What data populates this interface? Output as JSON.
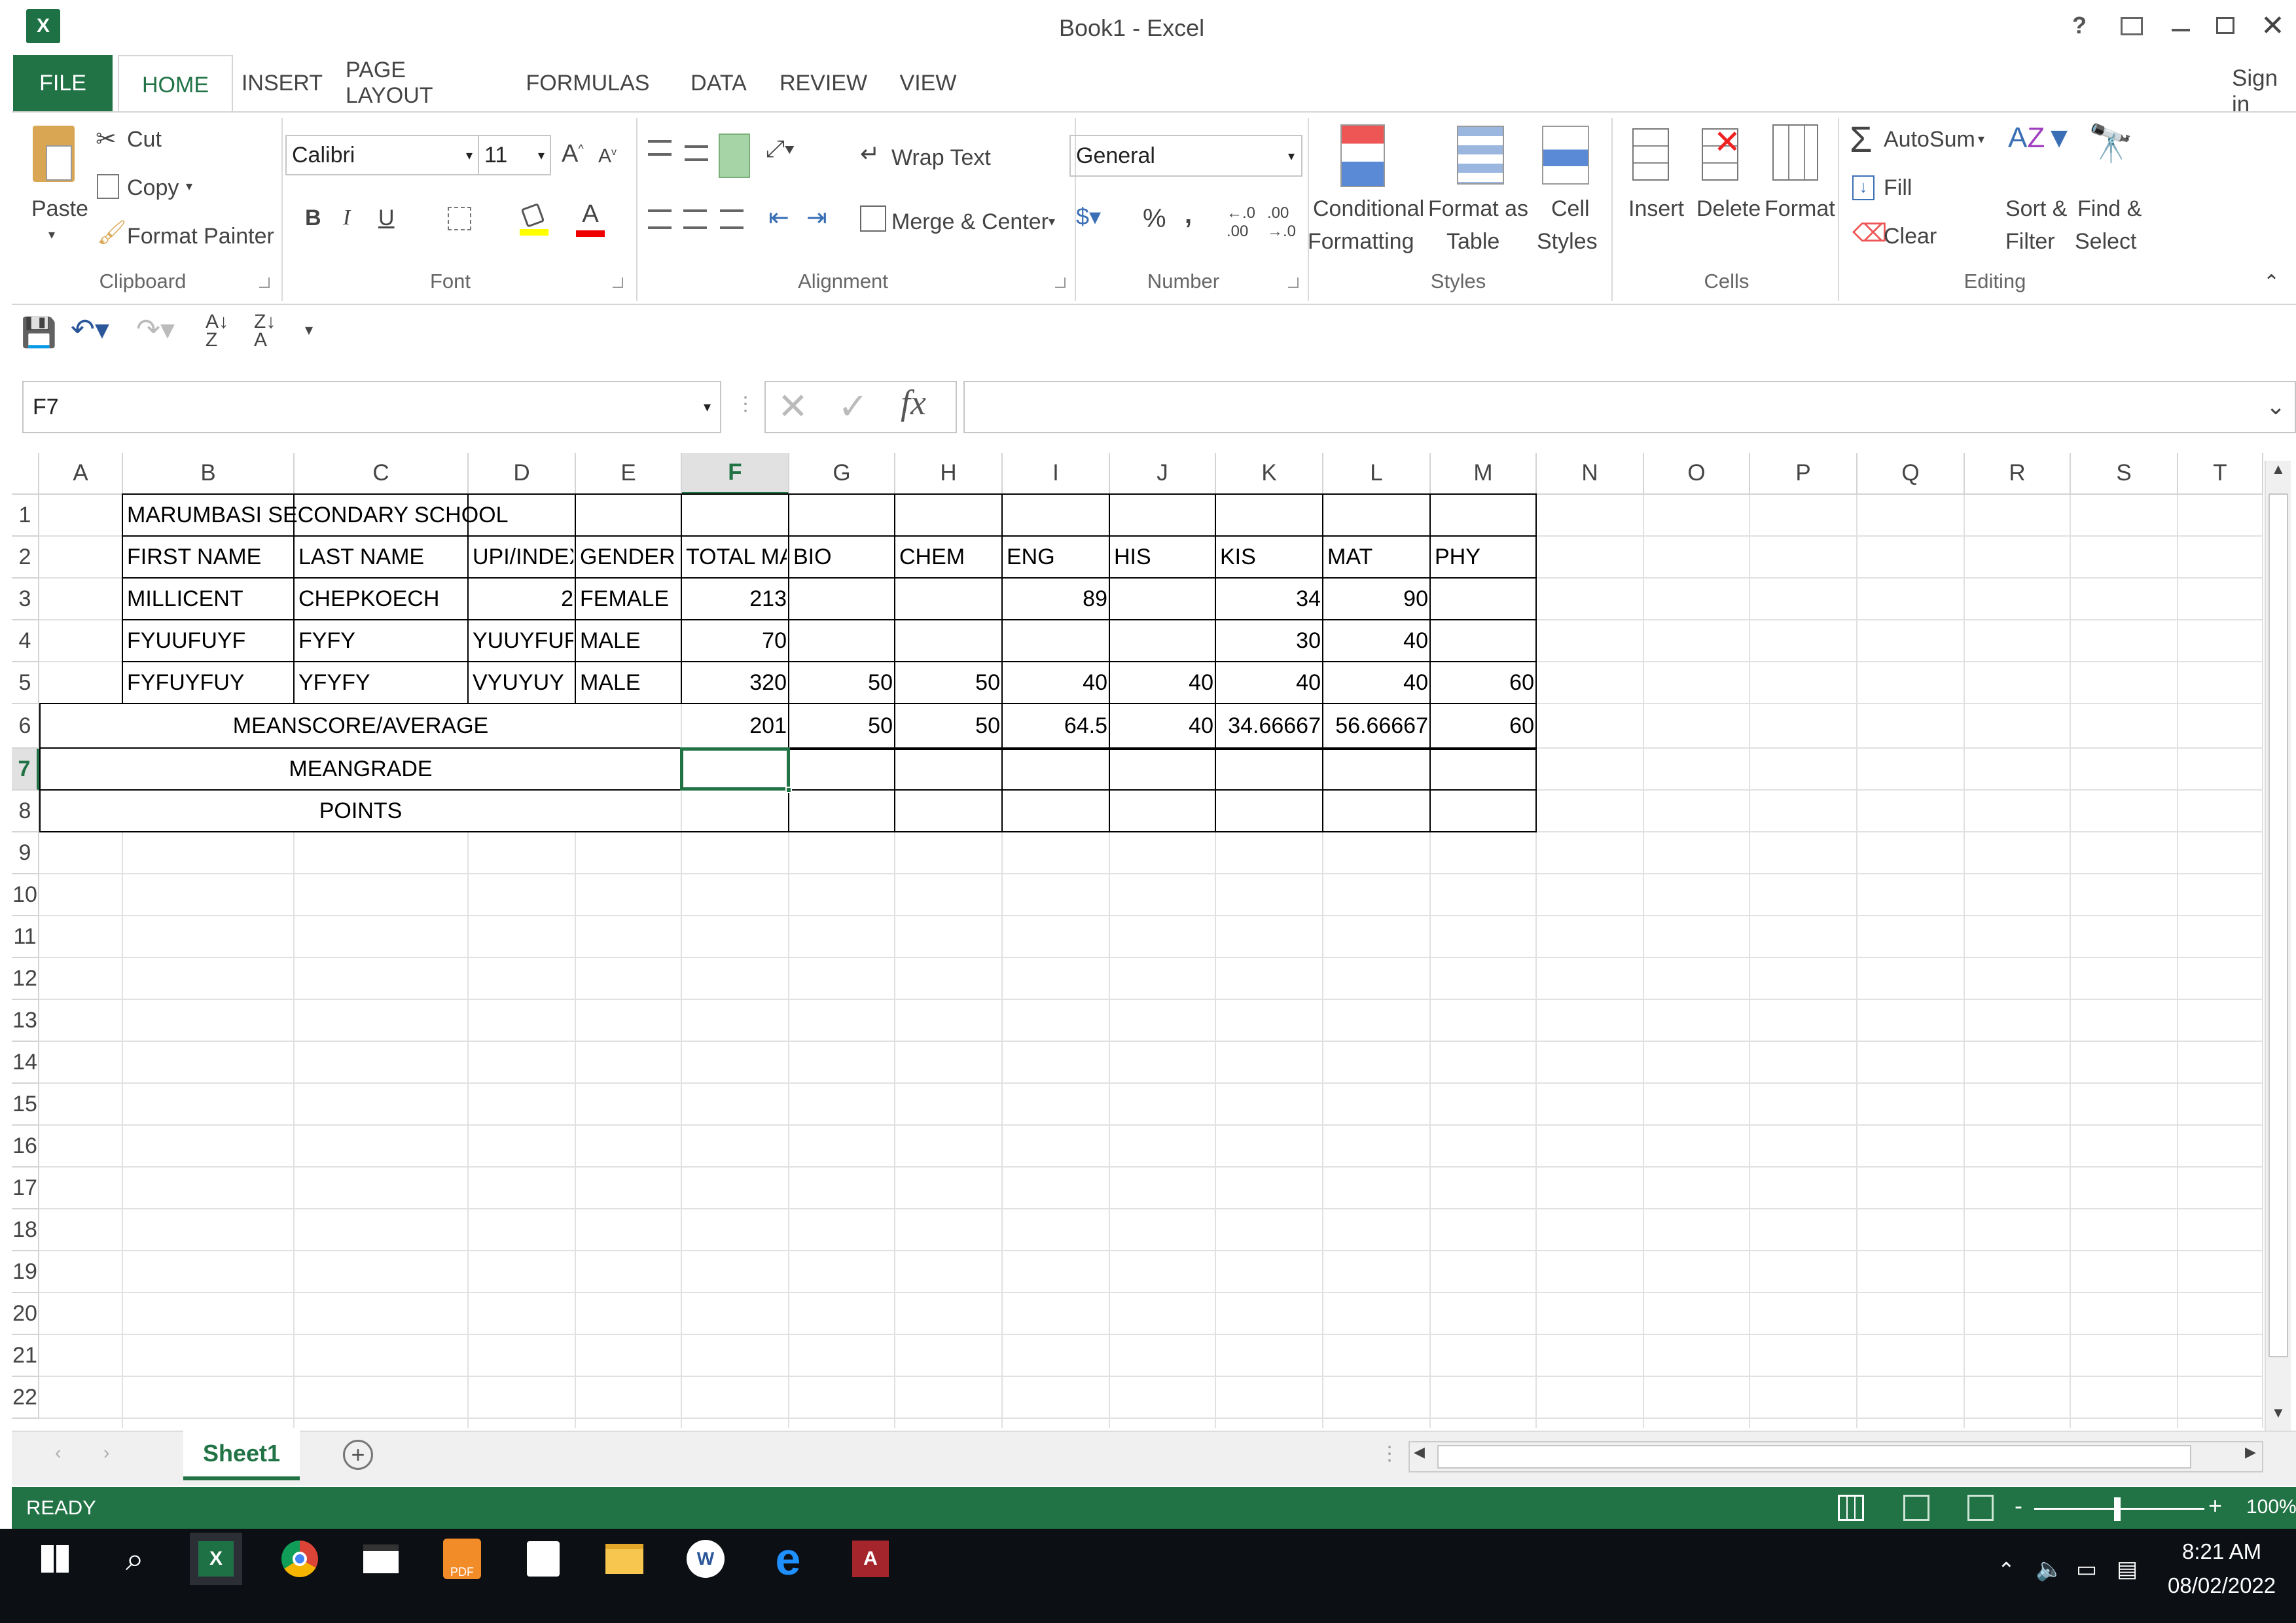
{
  "window": {
    "title": "Book1 - Excel",
    "sign_in": "Sign in",
    "help": "?"
  },
  "tabs": [
    "FILE",
    "HOME",
    "INSERT",
    "PAGE LAYOUT",
    "FORMULAS",
    "DATA",
    "REVIEW",
    "VIEW"
  ],
  "clipboard": {
    "paste": "Paste",
    "cut": "Cut",
    "copy": "Copy",
    "format_painter": "Format Painter",
    "group": "Clipboard"
  },
  "font": {
    "name": "Calibri",
    "size": "11",
    "group": "Font",
    "bold": "B",
    "italic": "I",
    "underline": "U"
  },
  "alignment": {
    "wrap": "Wrap Text",
    "merge": "Merge & Center",
    "group": "Alignment"
  },
  "number": {
    "format": "General",
    "group": "Number",
    "percent": "%",
    "comma": ","
  },
  "styles": {
    "cond1": "Conditional",
    "cond2": "Formatting",
    "fmt1": "Format as",
    "fmt2": "Table",
    "cell1": "Cell",
    "cell2": "Styles",
    "group": "Styles"
  },
  "cells": {
    "insert": "Insert",
    "delete": "Delete",
    "format": "Format",
    "group": "Cells"
  },
  "editing": {
    "autosum": "AutoSum",
    "fill": "Fill",
    "clear": "Clear",
    "sort1": "Sort &",
    "sort2": "Filter",
    "find1": "Find &",
    "find2": "Select",
    "group": "Editing"
  },
  "name_box": "F7",
  "fx": "fx",
  "columns": [
    "A",
    "B",
    "C",
    "D",
    "E",
    "F",
    "G",
    "H",
    "I",
    "J",
    "K",
    "L",
    "M",
    "N",
    "O",
    "P",
    "Q",
    "R",
    "S",
    "T"
  ],
  "rows": [
    "1",
    "2",
    "3",
    "4",
    "5",
    "6",
    "7",
    "8",
    "9",
    "10",
    "11",
    "12",
    "13",
    "14",
    "15",
    "16",
    "17",
    "18",
    "19",
    "20",
    "21",
    "22"
  ],
  "sheet": {
    "title": "MARUMBASI SECONDARY SCHOOL",
    "header": [
      "FIRST NAME",
      "LAST NAME",
      "UPI/INDEX",
      "GENDER",
      "TOTAL MA",
      "BIO",
      "CHEM",
      "ENG",
      "HIS",
      "KIS",
      "MAT",
      "PHY"
    ],
    "r3": {
      "b": "MILLICENT",
      "c": "CHEPKOECH",
      "d": "2",
      "e": "FEMALE",
      "f": "213",
      "i": "89",
      "k": "34",
      "l": "90"
    },
    "r4": {
      "b": "FYUUFUYF",
      "c": "FYFY",
      "d": "YUUYFUFY",
      "e": "MALE",
      "f": "70",
      "k": "30",
      "l": "40"
    },
    "r5": {
      "b": "FYFUYFUY",
      "c": "YFYFY",
      "d": "VYUYUY",
      "e": "MALE",
      "f": "320",
      "g": "50",
      "h": "50",
      "i": "40",
      "j": "40",
      "k": "40",
      "l": "40",
      "m": "60"
    },
    "r6": {
      "label": "MEANSCORE/AVERAGE",
      "f": "201",
      "g": "50",
      "h": "50",
      "i": "64.5",
      "j": "40",
      "k": "34.66667",
      "l": "56.66667",
      "m": "60"
    },
    "r7": {
      "label": "MEANGRADE"
    },
    "r8": {
      "label": "POINTS"
    }
  },
  "sheet_tab": "Sheet1",
  "status": {
    "ready": "READY",
    "zoom": "100%"
  },
  "taskbar": {
    "time": "8:21 AM",
    "date": "08/02/2022"
  }
}
